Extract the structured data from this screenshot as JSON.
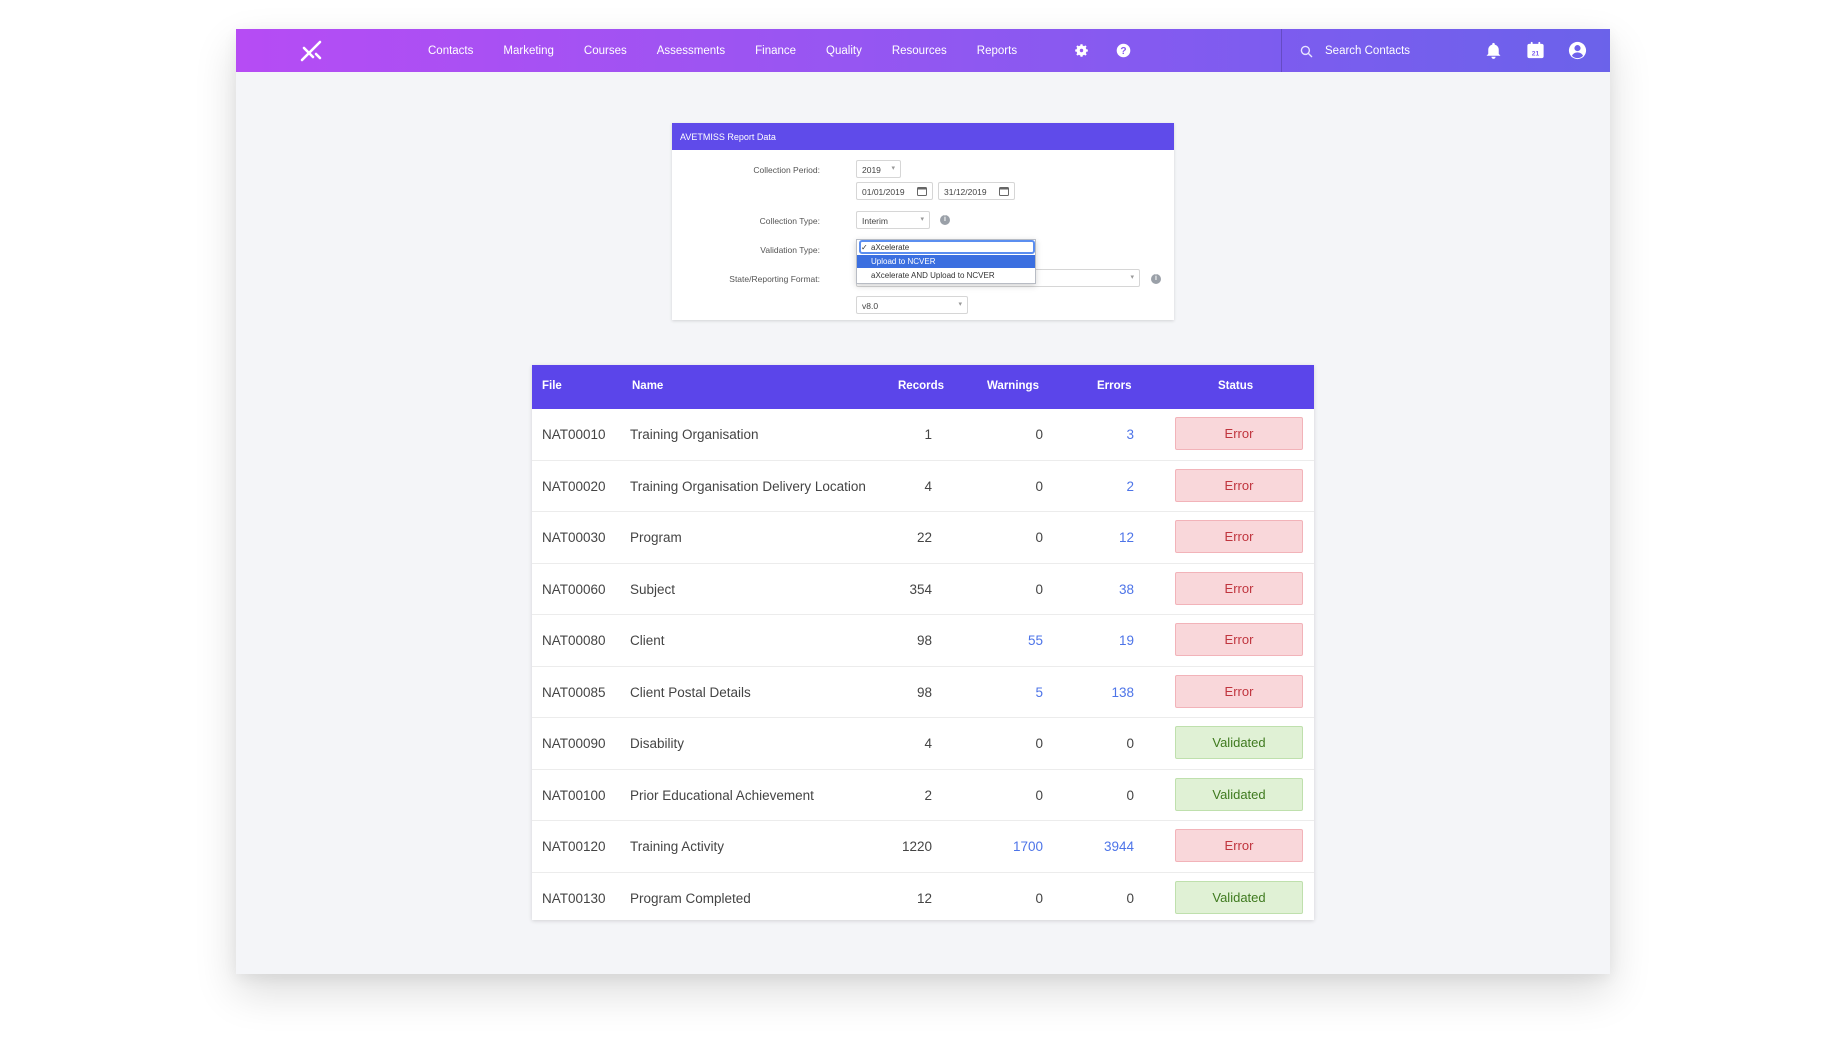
{
  "nav": {
    "items": [
      "Contacts",
      "Marketing",
      "Courses",
      "Assessments",
      "Finance",
      "Quality",
      "Resources",
      "Reports"
    ],
    "settings_icon": "gear-icon",
    "help_icon": "help-icon"
  },
  "search": {
    "placeholder": "Search Contacts"
  },
  "topbar_icons": {
    "notifications": "bell-icon",
    "calendar": "calendar-icon",
    "calendar_day": "21",
    "account": "user-circle-icon"
  },
  "form": {
    "title": "AVETMISS Report Data",
    "collection_period_label": "Collection Period:",
    "year": "2019",
    "start_date": "01/01/2019",
    "end_date": "31/12/2019",
    "collection_type_label": "Collection Type:",
    "collection_type": "Interim",
    "validation_type_label": "Validation Type:",
    "validation_options": [
      "aXcelerate",
      "Upload to NCVER",
      "aXcelerate AND Upload to NCVER"
    ],
    "validation_checked": "aXcelerate",
    "validation_highlighted": "Upload to NCVER",
    "state_format_label": "State/Reporting Format:",
    "version": "v8.0"
  },
  "table": {
    "headers": [
      "File",
      "Name",
      "Records",
      "Warnings",
      "Errors",
      "Status"
    ],
    "rows": [
      {
        "file": "NAT00010",
        "name": "Training Organisation",
        "records": "1",
        "warnings": "0",
        "errors": "3",
        "status": "Error"
      },
      {
        "file": "NAT00020",
        "name": "Training Organisation Delivery Location",
        "records": "4",
        "warnings": "0",
        "errors": "2",
        "status": "Error"
      },
      {
        "file": "NAT00030",
        "name": "Program",
        "records": "22",
        "warnings": "0",
        "errors": "12",
        "status": "Error"
      },
      {
        "file": "NAT00060",
        "name": "Subject",
        "records": "354",
        "warnings": "0",
        "errors": "38",
        "status": "Error"
      },
      {
        "file": "NAT00080",
        "name": "Client",
        "records": "98",
        "warnings": "55",
        "errors": "19",
        "status": "Error"
      },
      {
        "file": "NAT00085",
        "name": "Client Postal Details",
        "records": "98",
        "warnings": "5",
        "errors": "138",
        "status": "Error"
      },
      {
        "file": "NAT00090",
        "name": "Disability",
        "records": "4",
        "warnings": "0",
        "errors": "0",
        "status": "Validated"
      },
      {
        "file": "NAT00100",
        "name": "Prior Educational Achievement",
        "records": "2",
        "warnings": "0",
        "errors": "0",
        "status": "Validated"
      },
      {
        "file": "NAT00120",
        "name": "Training Activity",
        "records": "1220",
        "warnings": "1700",
        "errors": "3944",
        "status": "Error"
      },
      {
        "file": "NAT00130",
        "name": "Program Completed",
        "records": "12",
        "warnings": "0",
        "errors": "0",
        "status": "Validated"
      }
    ]
  },
  "colors": {
    "topbar_start": "#b64cf4",
    "topbar_end": "#6b62ea",
    "table_header": "#5b45ea",
    "form_header": "#5f4bea",
    "link_blue": "#4d74e8",
    "error_bg": "#f9d7da",
    "validated_bg": "#e0f1d5"
  }
}
